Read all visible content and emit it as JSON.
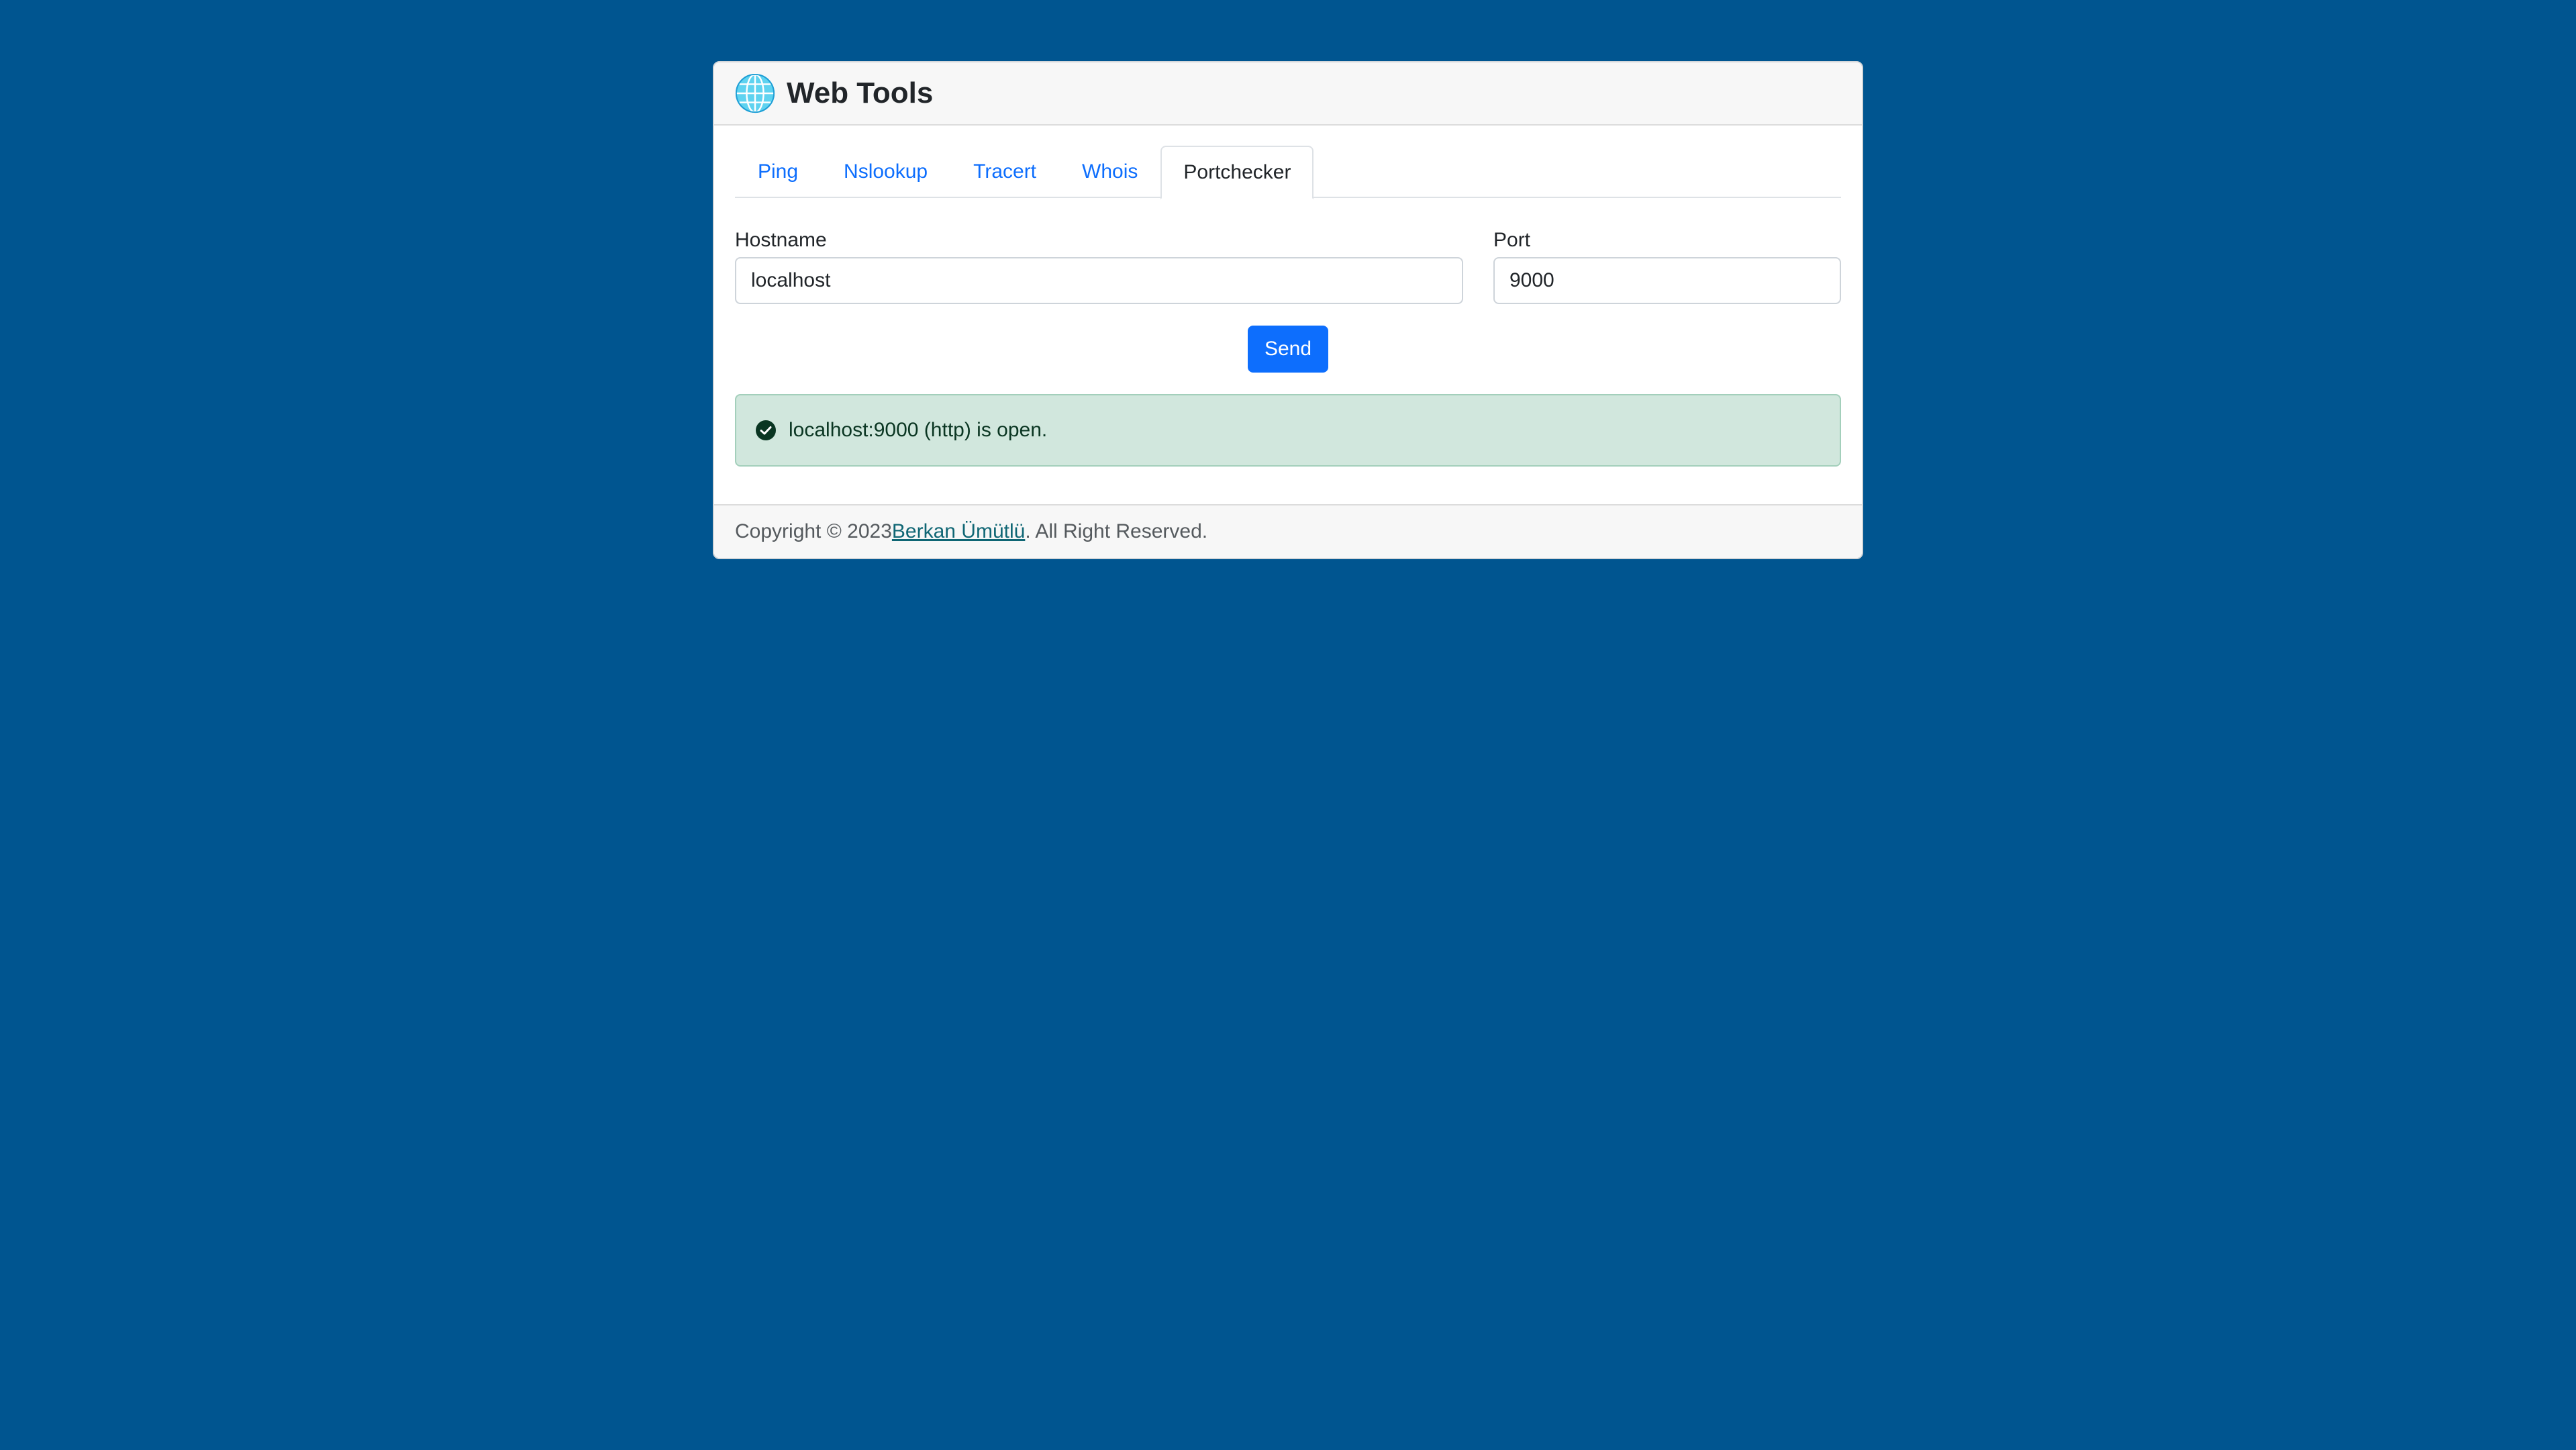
{
  "header": {
    "title": "Web Tools",
    "logo_icon": "globe-icon"
  },
  "tabs": [
    {
      "label": "Ping",
      "active": false
    },
    {
      "label": "Nslookup",
      "active": false
    },
    {
      "label": "Tracert",
      "active": false
    },
    {
      "label": "Whois",
      "active": false
    },
    {
      "label": "Portchecker",
      "active": true
    }
  ],
  "form": {
    "hostname_label": "Hostname",
    "hostname_value": "localhost",
    "port_label": "Port",
    "port_value": "9000",
    "send_label": "Send"
  },
  "result": {
    "icon": "check-circle-icon",
    "message": "localhost:9000 (http) is open."
  },
  "footer": {
    "prefix": "Copyright © 2023 ",
    "author": "Berkan Ümütlü",
    "suffix": ". All Right Reserved."
  },
  "colors": {
    "page_background": "#005590",
    "accent": "#0d6efd",
    "success_background": "#d1e7dd",
    "success_text": "#0a3622",
    "footer_link": "#0f6674"
  }
}
